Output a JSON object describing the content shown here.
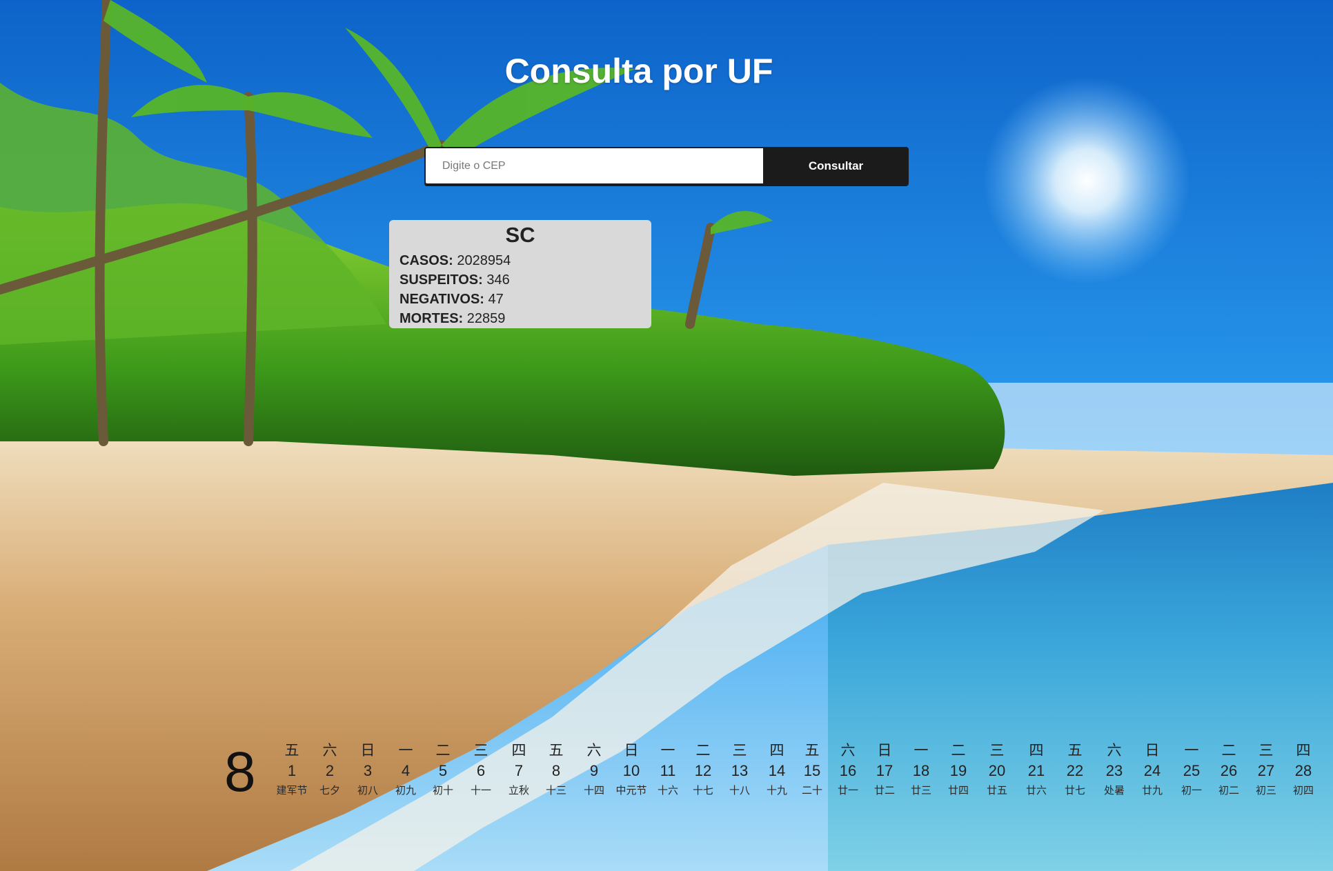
{
  "page": {
    "title": "Consulta por UF"
  },
  "search": {
    "placeholder": "Digite o CEP",
    "value": "",
    "button_label": "Consultar"
  },
  "result": {
    "uf": "SC",
    "stats": [
      {
        "label": "CASOS:",
        "value": "2028954"
      },
      {
        "label": "SUSPEITOS:",
        "value": "346"
      },
      {
        "label": "NEGATIVOS:",
        "value": "47"
      },
      {
        "label": "MORTES:",
        "value": "22859"
      }
    ]
  },
  "calendar": {
    "month": "8",
    "days": [
      {
        "weekday": "五",
        "day": "1",
        "lunar": "建军节"
      },
      {
        "weekday": "六",
        "day": "2",
        "lunar": "七夕"
      },
      {
        "weekday": "日",
        "day": "3",
        "lunar": "初八"
      },
      {
        "weekday": "一",
        "day": "4",
        "lunar": "初九"
      },
      {
        "weekday": "二",
        "day": "5",
        "lunar": "初十"
      },
      {
        "weekday": "三",
        "day": "6",
        "lunar": "十一"
      },
      {
        "weekday": "四",
        "day": "7",
        "lunar": "立秋"
      },
      {
        "weekday": "五",
        "day": "8",
        "lunar": "十三"
      },
      {
        "weekday": "六",
        "day": "9",
        "lunar": "十四"
      },
      {
        "weekday": "日",
        "day": "10",
        "lunar": "中元节"
      },
      {
        "weekday": "一",
        "day": "11",
        "lunar": "十六"
      },
      {
        "weekday": "二",
        "day": "12",
        "lunar": "十七"
      },
      {
        "weekday": "三",
        "day": "13",
        "lunar": "十八"
      },
      {
        "weekday": "四",
        "day": "14",
        "lunar": "十九"
      },
      {
        "weekday": "五",
        "day": "15",
        "lunar": "二十"
      },
      {
        "weekday": "六",
        "day": "16",
        "lunar": "廿一"
      },
      {
        "weekday": "日",
        "day": "17",
        "lunar": "廿二"
      },
      {
        "weekday": "一",
        "day": "18",
        "lunar": "廿三"
      },
      {
        "weekday": "二",
        "day": "19",
        "lunar": "廿四"
      },
      {
        "weekday": "三",
        "day": "20",
        "lunar": "廿五"
      },
      {
        "weekday": "四",
        "day": "21",
        "lunar": "廿六"
      },
      {
        "weekday": "五",
        "day": "22",
        "lunar": "廿七"
      },
      {
        "weekday": "六",
        "day": "23",
        "lunar": "处暑"
      },
      {
        "weekday": "日",
        "day": "24",
        "lunar": "廿九"
      },
      {
        "weekday": "一",
        "day": "25",
        "lunar": "初一"
      },
      {
        "weekday": "二",
        "day": "26",
        "lunar": "初二"
      },
      {
        "weekday": "三",
        "day": "27",
        "lunar": "初三"
      },
      {
        "weekday": "四",
        "day": "28",
        "lunar": "初四"
      }
    ]
  },
  "colors": {
    "sky": "#1f8fe8",
    "sand": "#d9b27a",
    "sea": "#3ea7d6",
    "foliage": "#4fa51f",
    "card_bg": "#d9d9d9",
    "button_bg": "#1b1b1b"
  }
}
